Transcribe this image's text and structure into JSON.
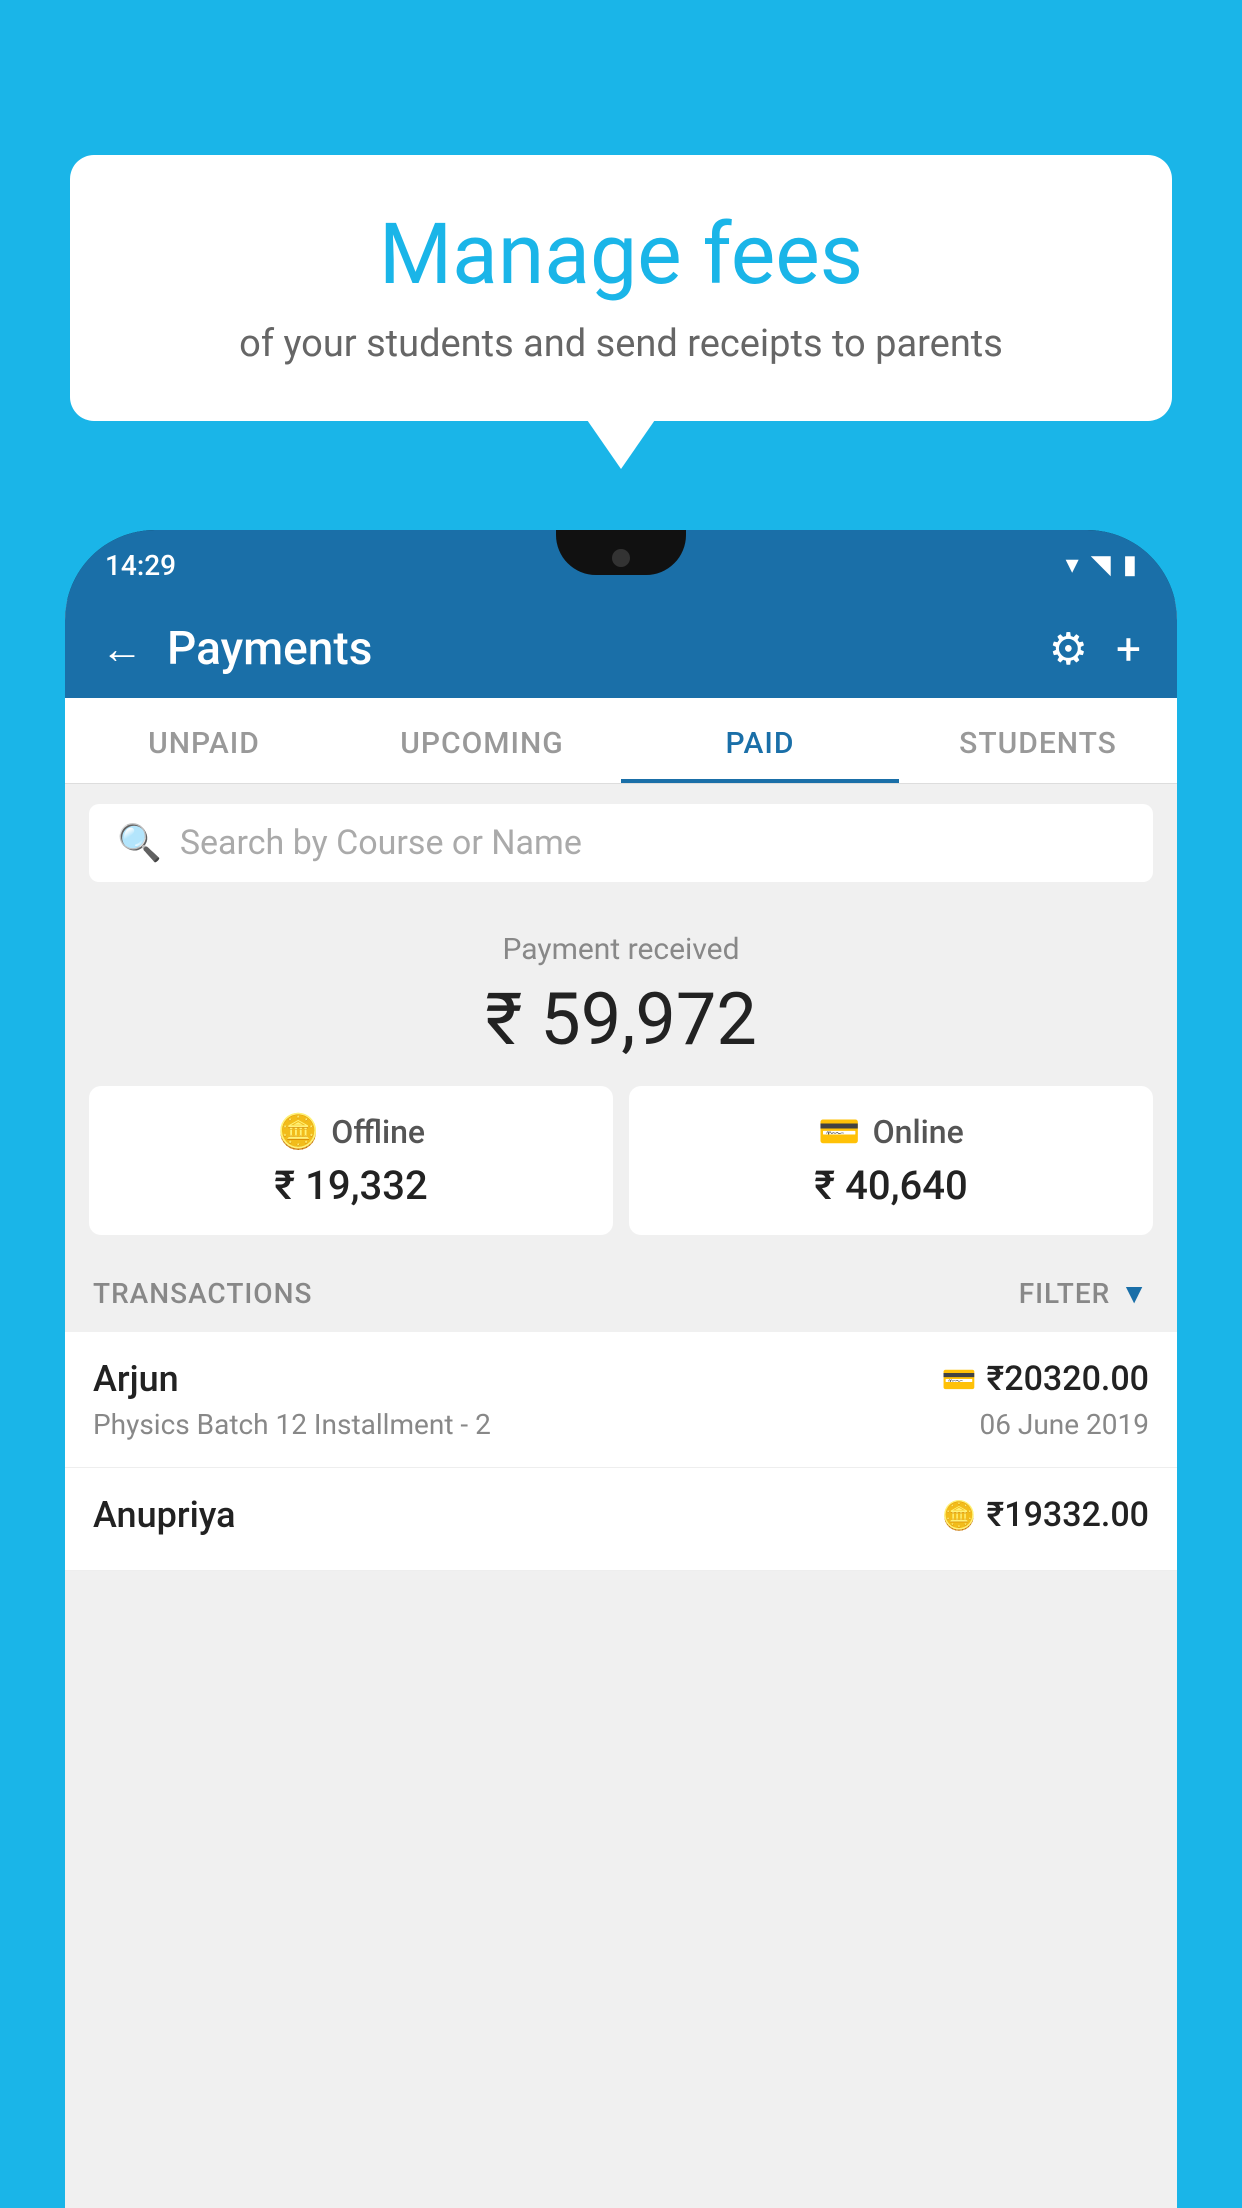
{
  "bubble": {
    "title": "Manage fees",
    "subtitle": "of your students and send receipts to parents"
  },
  "phone": {
    "status_time": "14:29",
    "wifi": "▾",
    "signal": "◥",
    "battery": "▮"
  },
  "header": {
    "title": "Payments",
    "back_label": "←",
    "gear_label": "⚙",
    "plus_label": "+"
  },
  "tabs": [
    {
      "label": "UNPAID",
      "active": false
    },
    {
      "label": "UPCOMING",
      "active": false
    },
    {
      "label": "PAID",
      "active": true
    },
    {
      "label": "STUDENTS",
      "active": false
    }
  ],
  "search": {
    "placeholder": "Search by Course or Name"
  },
  "payment": {
    "received_label": "Payment received",
    "total_amount": "₹ 59,972",
    "offline_label": "Offline",
    "offline_amount": "₹ 19,332",
    "online_label": "Online",
    "online_amount": "₹ 40,640"
  },
  "transactions": {
    "label": "TRANSACTIONS",
    "filter_label": "FILTER"
  },
  "transaction_list": [
    {
      "name": "Arjun",
      "course": "Physics Batch 12 Installment - 2",
      "amount": "₹20320.00",
      "date": "06 June 2019",
      "payment_type": "online"
    },
    {
      "name": "Anupriya",
      "course": "",
      "amount": "₹19332.00",
      "date": "",
      "payment_type": "offline"
    }
  ]
}
